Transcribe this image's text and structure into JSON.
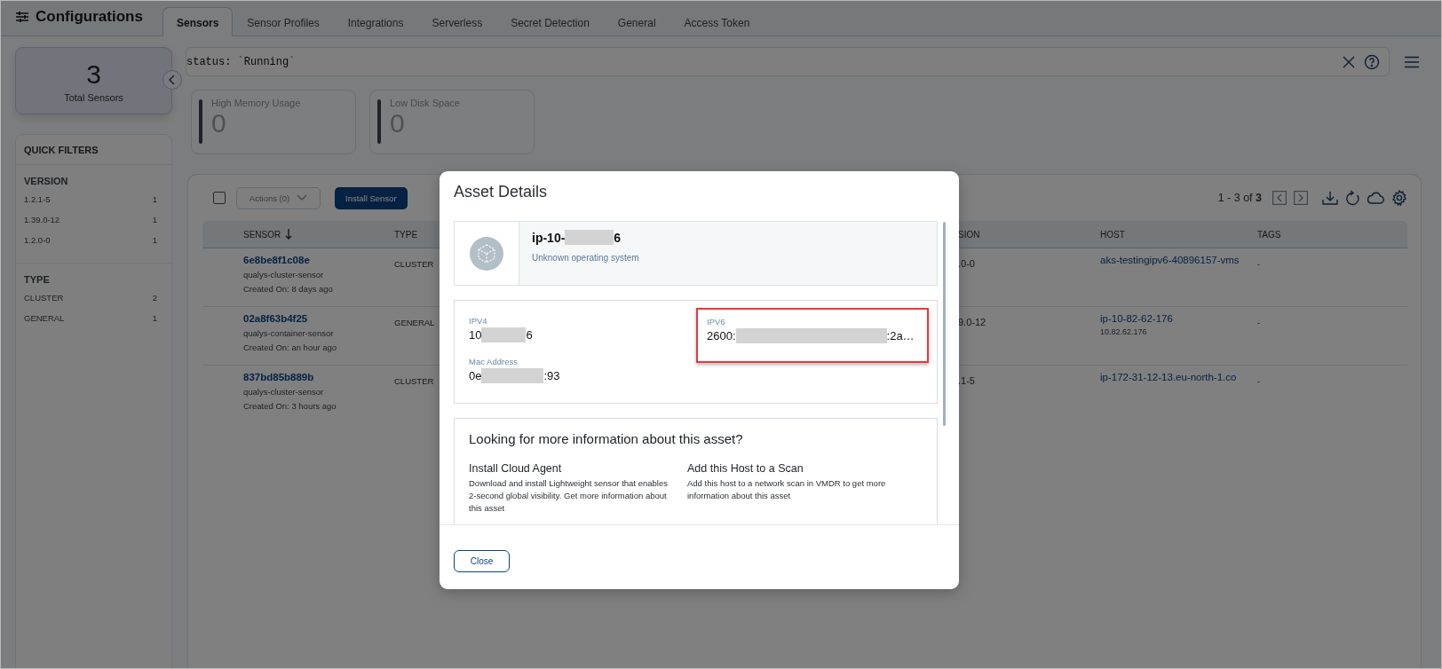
{
  "app": {
    "title": "Configurations"
  },
  "tabs": [
    {
      "label": "Sensors",
      "selected": true
    },
    {
      "label": "Sensor Profiles",
      "selected": false
    },
    {
      "label": "Integrations",
      "selected": false
    },
    {
      "label": "Serverless",
      "selected": false
    },
    {
      "label": "Secret Detection",
      "selected": false
    },
    {
      "label": "General",
      "selected": false
    },
    {
      "label": "Access Token",
      "selected": false
    }
  ],
  "summary": {
    "count": "3",
    "label": "Total Sensors"
  },
  "quick_filters": {
    "title": "QUICK FILTERS",
    "groups": [
      {
        "title": "VERSION",
        "items": [
          {
            "label": "1.2.1-5",
            "count": "1"
          },
          {
            "label": "1.39.0-12",
            "count": "1"
          },
          {
            "label": "1.2.0-0",
            "count": "1"
          }
        ]
      },
      {
        "title": "TYPE",
        "items": [
          {
            "label": "CLUSTER",
            "count": "2"
          },
          {
            "label": "GENERAL",
            "count": "1"
          }
        ]
      }
    ]
  },
  "search": {
    "value": "status: `Running`"
  },
  "metrics": [
    {
      "label": "High Memory Usage",
      "value": "0"
    },
    {
      "label": "Low Disk Space",
      "value": "0"
    }
  ],
  "toolbar": {
    "select_all": {
      "checked": false
    },
    "actions": {
      "label": "Actions (0)",
      "disabled": true
    },
    "install": "Install Sensor",
    "range": "1 - 3 of **3**"
  },
  "table": {
    "columns": [
      {
        "label": "SENSOR",
        "sorted": true
      },
      {
        "label": "TYPE",
        "sorted": false
      },
      {
        "label": "SION",
        "sorted": false
      },
      {
        "label": "HOST",
        "sorted": false
      },
      {
        "label": "TAGS",
        "sorted": false
      }
    ],
    "rows": [
      {
        "sensor": "6e8be8f1c08e",
        "profile": "qualys-cluster-sensor",
        "created": "Created On: 8 days ago",
        "type": "CLUSTER",
        "version": ".0-0",
        "host": "aks-testingipv6-40896157-vms",
        "host_ip": null,
        "tags": "-"
      },
      {
        "sensor": "02a8f63b4f25",
        "profile": "qualys-container-sensor",
        "created": "Created On: an hour ago",
        "type": "GENERAL",
        "version": "9.0-12",
        "host": "ip-10-82-62-176",
        "host_ip": "10.82.62.176",
        "tags": "-"
      },
      {
        "sensor": "837bd85b889b",
        "profile": "qualys-cluster-sensor",
        "created": "Created On: 3 hours ago",
        "type": "CLUSTER",
        "version": ".1-5",
        "host": "ip-172-31-12-13.eu-north-1.co",
        "host_ip": null,
        "tags": "-"
      }
    ]
  },
  "dialog": {
    "title": "Asset Details",
    "asset": {
      "name_prefix": "ip-10-",
      "name_suffix": "6",
      "os": "Unknown operating system"
    },
    "fields": [
      {
        "label": "IPV4",
        "prefix": "10",
        "suffix": "6",
        "highlighted": false
      },
      {
        "label": "IPV6",
        "prefix": "2600:",
        "suffix": ":2a…",
        "highlighted": true
      },
      {
        "label": "Mac Address",
        "prefix": "0e",
        "suffix": ":93",
        "highlighted": false
      }
    ],
    "more_info": {
      "title": "Looking for more information about this asset?",
      "options": [
        {
          "title": "Install Cloud Agent",
          "text": "Download and install Lightweight sensor that enables 2-second global visibility. Get more information about this asset"
        },
        {
          "title": "Add this Host to a Scan",
          "text": "Add this host to a network scan in VMDR to get more information about this asset"
        }
      ]
    },
    "close": "Close"
  }
}
